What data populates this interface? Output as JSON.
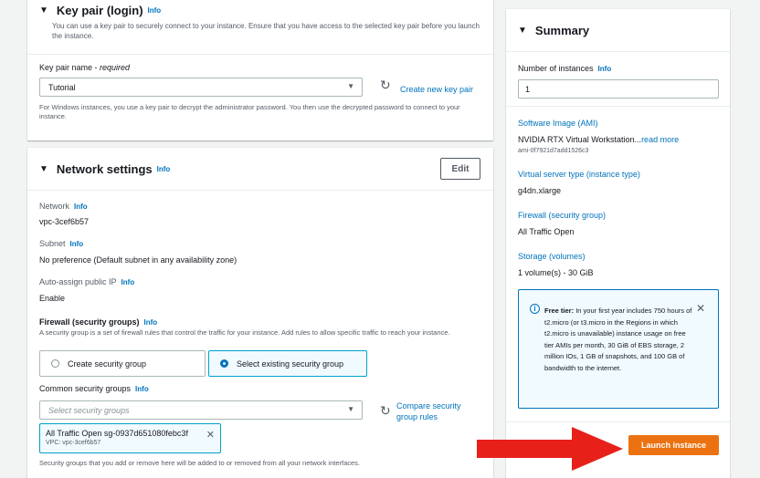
{
  "key_pair": {
    "title": "Key pair (login)",
    "info": "Info",
    "description": "You can use a key pair to securely connect to your instance. Ensure that you have access to the selected key pair before you launch the instance.",
    "label": "Key pair name - ",
    "label_required": "required",
    "selected": "Tutorial",
    "create_link": "Create new key pair",
    "help": "For Windows instances, you use a key pair to decrypt the administrator password. You then use the decrypted password to connect to your instance."
  },
  "network": {
    "title": "Network settings",
    "info": "Info",
    "edit_label": "Edit",
    "network_label": "Network",
    "network_value": "vpc-3cef6b57",
    "subnet_label": "Subnet",
    "subnet_value": "No preference (Default subnet in any availability zone)",
    "public_ip_label": "Auto-assign public IP",
    "public_ip_value": "Enable",
    "firewall_title": "Firewall (security groups)",
    "firewall_desc": "A security group is a set of firewall rules that control the traffic for your instance. Add rules to allow specific traffic to reach your instance.",
    "option_create": "Create security group",
    "option_existing": "Select existing security group",
    "common_label": "Common security groups",
    "sg_placeholder": "Select security groups",
    "compare_link": "Compare security group rules",
    "token_main": "All Traffic Open  sg-0937d651080febc3f",
    "token_sub": "VPC: vpc-3cef6b57",
    "sg_help": "Security groups that you add or remove here will be added to or removed from all your network interfaces."
  },
  "summary": {
    "title": "Summary",
    "instances_label": "Number of instances",
    "info": "Info",
    "instances_value": "1",
    "ami_label": "Software Image (AMI)",
    "ami_value": "NVIDIA RTX Virtual Workstation...",
    "ami_more": "read more",
    "ami_id": "ami-0f7921d7add1526c3",
    "type_label": "Virtual server type (instance type)",
    "type_value": "g4dn.xlarge",
    "firewall_label": "Firewall (security group)",
    "firewall_value": "All Traffic Open",
    "storage_label": "Storage (volumes)",
    "storage_value": "1 volume(s) - 30 GiB",
    "free_tier_bold": "Free tier:",
    "free_tier_text": " In your first year includes 750 hours of t2.micro (or t3.micro in the Regions in which t2.micro is unavailable) instance usage on free tier AMIs per month, 30 GiB of EBS storage, 2 million IOs, 1 GB of snapshots, and 100 GB of bandwidth to the internet.",
    "launch_label": "Launch instance"
  },
  "colors": {
    "accent": "#0073bb",
    "launch": "#ec7211",
    "annotation_arrow": "#e8201a"
  }
}
